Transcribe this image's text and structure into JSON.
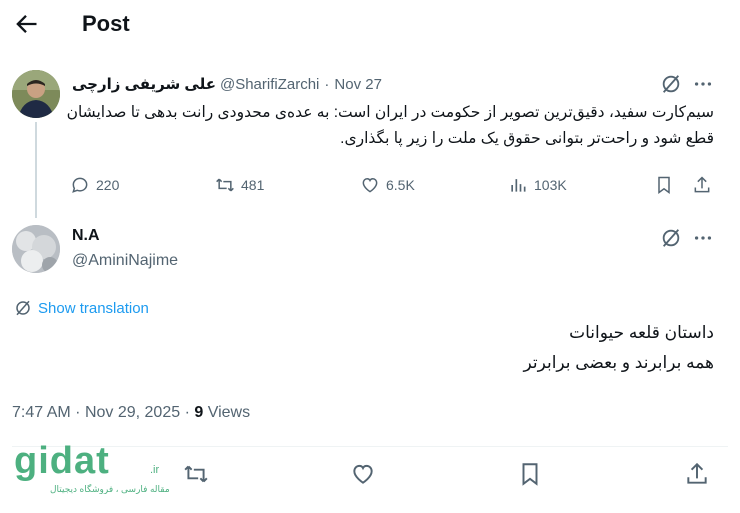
{
  "header": {
    "title": "Post"
  },
  "parent_tweet": {
    "author_name": "علی شریفی زارچی",
    "handle": "@SharifiZarchi",
    "dot": "·",
    "date": "Nov 27",
    "text": "سیم‌کارت سفید، دقیق‌ترین تصویر از حکومت در ایران است: به عده‌ی محدودی رانت بدهی تا صدایشان قطع شود و راحت‌تر بتوانی حقوق یک ملت را زیر پا بگذاری.",
    "replies": "220",
    "reposts": "481",
    "likes": "6.5K",
    "views": "103K"
  },
  "reply_tweet": {
    "author_name": "N.A",
    "handle": "@AminiNajime",
    "show_translation": "Show translation",
    "line1": "داستان قلعه حیوانات",
    "line2": "همه برابرند و بعضی برابرتر",
    "time": "7:47 AM",
    "sep": "·",
    "date": "Nov 29, 2025",
    "views_count": "9",
    "views_label": "Views"
  },
  "watermark": {
    "logo": "gidat",
    "suffix": ".ir",
    "tagline": "مقاله فارسی ، فروشگاه دیجیتال"
  },
  "icons": {
    "back": "arrow-left-icon",
    "grok": "grok-icon",
    "more": "more-icon",
    "reply": "reply-icon",
    "repost": "repost-icon",
    "like": "heart-icon",
    "views": "views-icon",
    "bookmark": "bookmark-icon",
    "share": "share-icon"
  },
  "colors": {
    "link": "#1d9bf0",
    "muted": "#536471",
    "text": "#0f1419",
    "watermark": "#2fa36b"
  }
}
